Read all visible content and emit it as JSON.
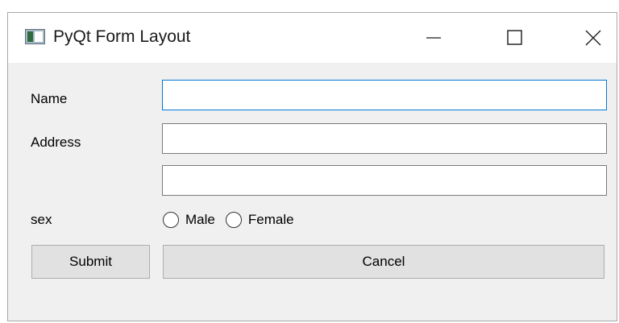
{
  "window": {
    "title": "PyQt Form Layout",
    "controls": {
      "minimize": "minimize-icon",
      "maximize": "maximize-icon",
      "close": "close-icon"
    }
  },
  "form": {
    "name_label": "Name",
    "name_value": "",
    "address_label": "Address",
    "address_line1_value": "",
    "address_line2_value": "",
    "sex_label": "sex",
    "sex_options": [
      "Male",
      "Female"
    ],
    "sex_selected": null
  },
  "buttons": {
    "submit_label": "Submit",
    "cancel_label": "Cancel"
  },
  "colors": {
    "focus_border": "#0078d7",
    "window_bg": "#f0f0f0",
    "button_bg": "#e1e1e1"
  }
}
